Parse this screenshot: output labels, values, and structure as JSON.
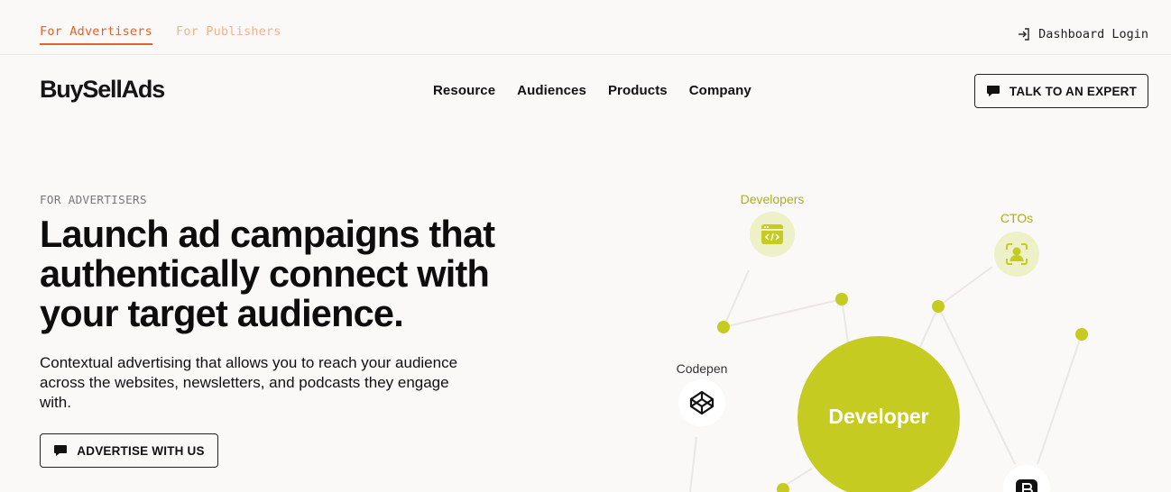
{
  "audience_tabs": [
    {
      "label": "For Advertisers",
      "active": true
    },
    {
      "label": "For Publishers",
      "active": false
    }
  ],
  "dashboard_login": "Dashboard Login",
  "logo": "BuySellAds",
  "nav": [
    "Resource",
    "Audiences",
    "Products",
    "Company"
  ],
  "cta_expert": "TALK TO AN EXPERT",
  "hero": {
    "eyebrow": "FOR ADVERTISERS",
    "title": "Launch ad campaigns that authentically connect with your target audience.",
    "subtitle": "Contextual advertising that allows you to reach your audience across the websites, newsletters, and podcasts they engage with.",
    "cta": "ADVERTISE WITH US"
  },
  "graph": {
    "center": "Developer",
    "nodes": [
      {
        "label": "Developers",
        "icon": "code-window-icon"
      },
      {
        "label": "CTOs",
        "icon": "user-scan-icon"
      },
      {
        "label": "Codepen",
        "icon": "codepen-icon"
      },
      {
        "label": "",
        "icon": "bootstrap-icon"
      }
    ]
  },
  "colors": {
    "accent": "#e0642a",
    "accent_light": "#f0b48f",
    "lime": "#c6cb22",
    "lime_light": "#eef0c8",
    "background": "#fbf8f8"
  }
}
